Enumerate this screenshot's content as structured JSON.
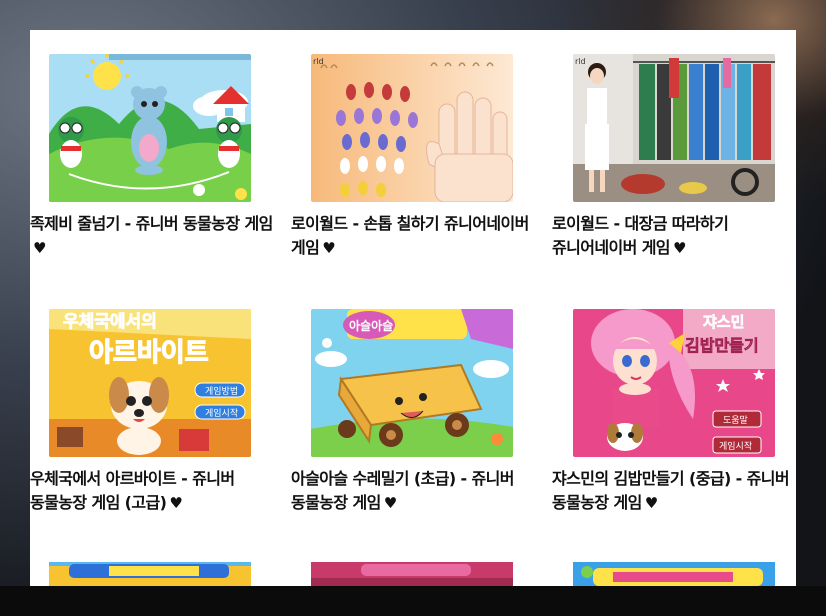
{
  "games": [
    {
      "title": "족제비 줄넘기 - 쥬니버 동물농장 게임",
      "heart": "♥"
    },
    {
      "title": "로이월드 - 손톱 칠하기 쥬니어네이버 게임",
      "heart": "♥"
    },
    {
      "title": "로이월드 - 대장금 따라하기 쥬니어네이버 게임",
      "heart": "♥"
    },
    {
      "title": "우체국에서 아르바이트 - 쥬니버 동물농장 게임 (고급)",
      "heart": "♥"
    },
    {
      "title": "아슬아슬 수레밀기 (초급) - 쥬니버 동물농장 게임",
      "heart": "♥"
    },
    {
      "title": "쟈스민의 김밥만들기 (중급) - 쥬니버 동물농장 게임",
      "heart": "♥"
    }
  ],
  "thumb_text": {
    "post_office_top": "우체국에서의",
    "post_office_main": "아르바이트",
    "post_office_btn1": "게임방법",
    "post_office_btn2": "게임시작",
    "cart_sign": "아슬아슬",
    "kimbap_top": "쟈스민",
    "kimbap_main": "김밥만들기",
    "kimbap_btn1": "도움말",
    "kimbap_btn2": "게임시작",
    "nail_brand": "rld",
    "dress_brand": "rld"
  },
  "colors": {
    "panel": "#ffffff",
    "caption_text": "#111111"
  }
}
